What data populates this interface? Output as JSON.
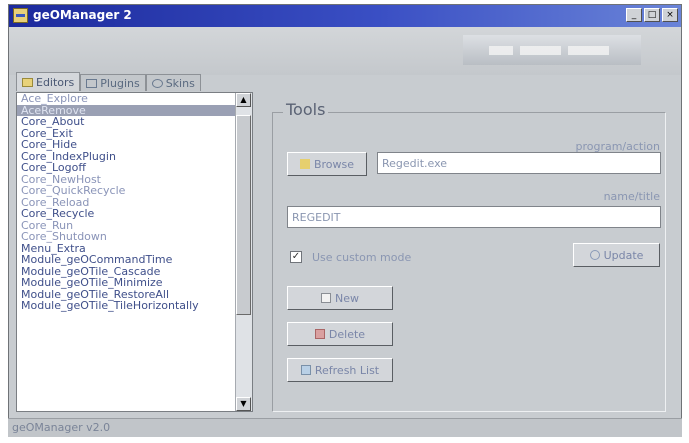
{
  "window": {
    "title": "geOManager 2",
    "controls": [
      "_",
      "□",
      "×"
    ],
    "logo_text": ""
  },
  "tabs": [
    {
      "label": "Editors",
      "icon": "folder-icon"
    },
    {
      "label": "Plugins",
      "icon": "plugin-icon"
    },
    {
      "label": "Skins",
      "icon": "skin-icon"
    }
  ],
  "list": {
    "items": [
      "Ace_Explore",
      "AceRemove",
      "Core_About",
      "Core_Exit",
      "Core_Hide",
      "Core_IndexPlugin",
      "Core_Logoff",
      "Core_NewHost",
      "Core_QuickRecycle",
      "Core_Reload",
      "Core_Recycle",
      "Core_Run",
      "Core_Shutdown",
      "Menu_Extra",
      "Module_geOCommandTime",
      "Module_geOTile_Cascade",
      "Module_geOTile_Minimize",
      "Module_geOTile_RestoreAll",
      "Module_geOTile_TileHorizontally"
    ],
    "selected_index": 1,
    "muted_indices": [
      0,
      7,
      8,
      9,
      11,
      12
    ]
  },
  "tools": {
    "title": "Tools",
    "browse_label": "Browse",
    "program_label": "program/action",
    "program_value": "Regedit.exe",
    "name_label": "name/title",
    "name_value": "REGEDIT",
    "checkbox_checked": true,
    "checkbox_label": "Use custom mode",
    "update_label": "Update",
    "new_label": "New",
    "delete_label": "Delete",
    "refresh_label": "Refresh List"
  },
  "status": {
    "text": "geOManager v2.0"
  },
  "colors": {
    "title_bar_start": "#1c2a9c",
    "title_bar_end": "#6a84d8",
    "window_bg": "#c8ccd0",
    "selection_bg": "#9aa0b4"
  }
}
